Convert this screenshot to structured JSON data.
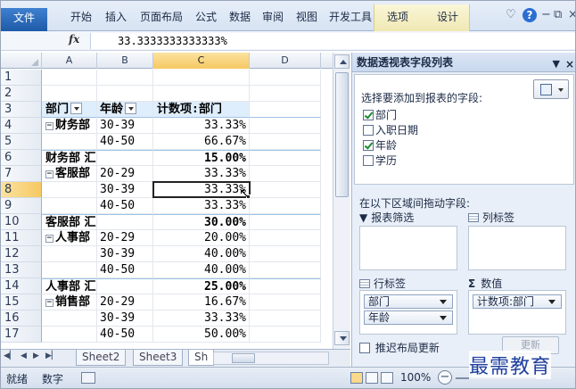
{
  "ribbon": {
    "file_tab": "文件",
    "tabs": [
      "开始",
      "插入",
      "页面布局",
      "公式",
      "数据",
      "审阅",
      "视图",
      "开发工具"
    ],
    "context_tabs": [
      "选项",
      "设计"
    ]
  },
  "formula_bar": {
    "fx": "fx",
    "value": "33.3333333333333%"
  },
  "grid": {
    "columns": [
      "A",
      "B",
      "C",
      "D"
    ],
    "selected_column": "C",
    "rows": [
      {
        "num": "1",
        "a": "",
        "b": "",
        "c": ""
      },
      {
        "num": "2",
        "a": "",
        "b": "",
        "c": ""
      },
      {
        "num": "3",
        "a": "部门",
        "b": "年龄",
        "c": "计数项:部门",
        "header": true
      },
      {
        "num": "4",
        "a": "财务部",
        "b": "30-39",
        "c": "33.33%",
        "group": true
      },
      {
        "num": "5",
        "a": "",
        "b": "40-50",
        "c": "66.67%"
      },
      {
        "num": "6",
        "a": "财务部 汇总",
        "b": "",
        "c": "15.00%",
        "subtotal": true
      },
      {
        "num": "7",
        "a": "客服部",
        "b": "20-29",
        "c": "33.33%",
        "group": true
      },
      {
        "num": "8",
        "a": "",
        "b": "30-39",
        "c": "33.33%",
        "selected": true
      },
      {
        "num": "9",
        "a": "",
        "b": "40-50",
        "c": "33.33%"
      },
      {
        "num": "10",
        "a": "客服部 汇总",
        "b": "",
        "c": "30.00%",
        "subtotal": true
      },
      {
        "num": "11",
        "a": "人事部",
        "b": "20-29",
        "c": "20.00%",
        "group": true
      },
      {
        "num": "12",
        "a": "",
        "b": "30-39",
        "c": "40.00%"
      },
      {
        "num": "13",
        "a": "",
        "b": "40-50",
        "c": "40.00%"
      },
      {
        "num": "14",
        "a": "人事部 汇总",
        "b": "",
        "c": "25.00%",
        "subtotal": true
      },
      {
        "num": "15",
        "a": "销售部",
        "b": "20-29",
        "c": "16.67%",
        "group": true
      },
      {
        "num": "16",
        "a": "",
        "b": "30-39",
        "c": "33.33%"
      },
      {
        "num": "17",
        "a": "",
        "b": "40-50",
        "c": "50.00%"
      }
    ]
  },
  "sheet_tabs": [
    "Sheet2",
    "Sheet3",
    "Sh"
  ],
  "status_bar": {
    "ready": "就绪",
    "mode": "数字",
    "zoom": "100%"
  },
  "pivot_panel": {
    "title": "数据透视表字段列表",
    "choose_label": "选择要添加到报表的字段:",
    "fields": [
      {
        "label": "部门",
        "checked": true
      },
      {
        "label": "入职日期",
        "checked": false
      },
      {
        "label": "年龄",
        "checked": true
      },
      {
        "label": "学历",
        "checked": false
      }
    ],
    "drag_label": "在以下区域间拖动字段:",
    "areas": {
      "filter": "报表筛选",
      "columns": "列标签",
      "rows": "行标签",
      "values": "数值"
    },
    "row_fields": [
      "部门",
      "年龄"
    ],
    "value_fields": [
      "计数项:部门"
    ],
    "defer_label": "推迟布局更新",
    "update_button": "更新"
  },
  "watermark": "最需教育"
}
